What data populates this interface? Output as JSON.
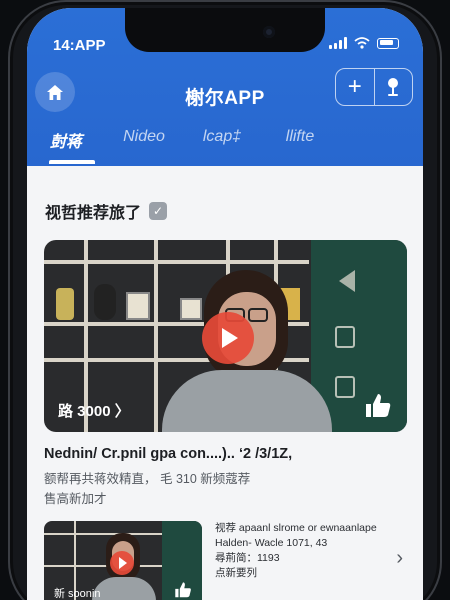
{
  "status_bar": {
    "time": "14:APP"
  },
  "header": {
    "title": "榭尔APP",
    "add_label": "+",
    "tabs": [
      {
        "label": "尌蒋",
        "active": true
      },
      {
        "label": "Nideo",
        "active": false
      },
      {
        "label": "lcap‡",
        "active": false
      },
      {
        "label": "llifte",
        "active": false
      }
    ]
  },
  "section": {
    "title": "视哲推荐旅了"
  },
  "featured": {
    "caption": "路 3000 〉",
    "title": "Nednin/ Cr.pnil gpa con....).. ‘2 /3/1Z,",
    "meta": "额帮再共蒋效精直， 毛 310 新频蔻荐",
    "tag": "售高新加才"
  },
  "list_item": {
    "thumb_caption": "新 soonin",
    "line1": "视荐 apaanl slrome or ewnaanlape",
    "line2": "Halden- Wacle 1071, 43",
    "line3": "尋荊简：1193",
    "line4": "点新要列"
  },
  "colors": {
    "header_blue": "#2b6fd6",
    "play_red": "#e64a38",
    "wall_green": "#1f4a3f"
  }
}
